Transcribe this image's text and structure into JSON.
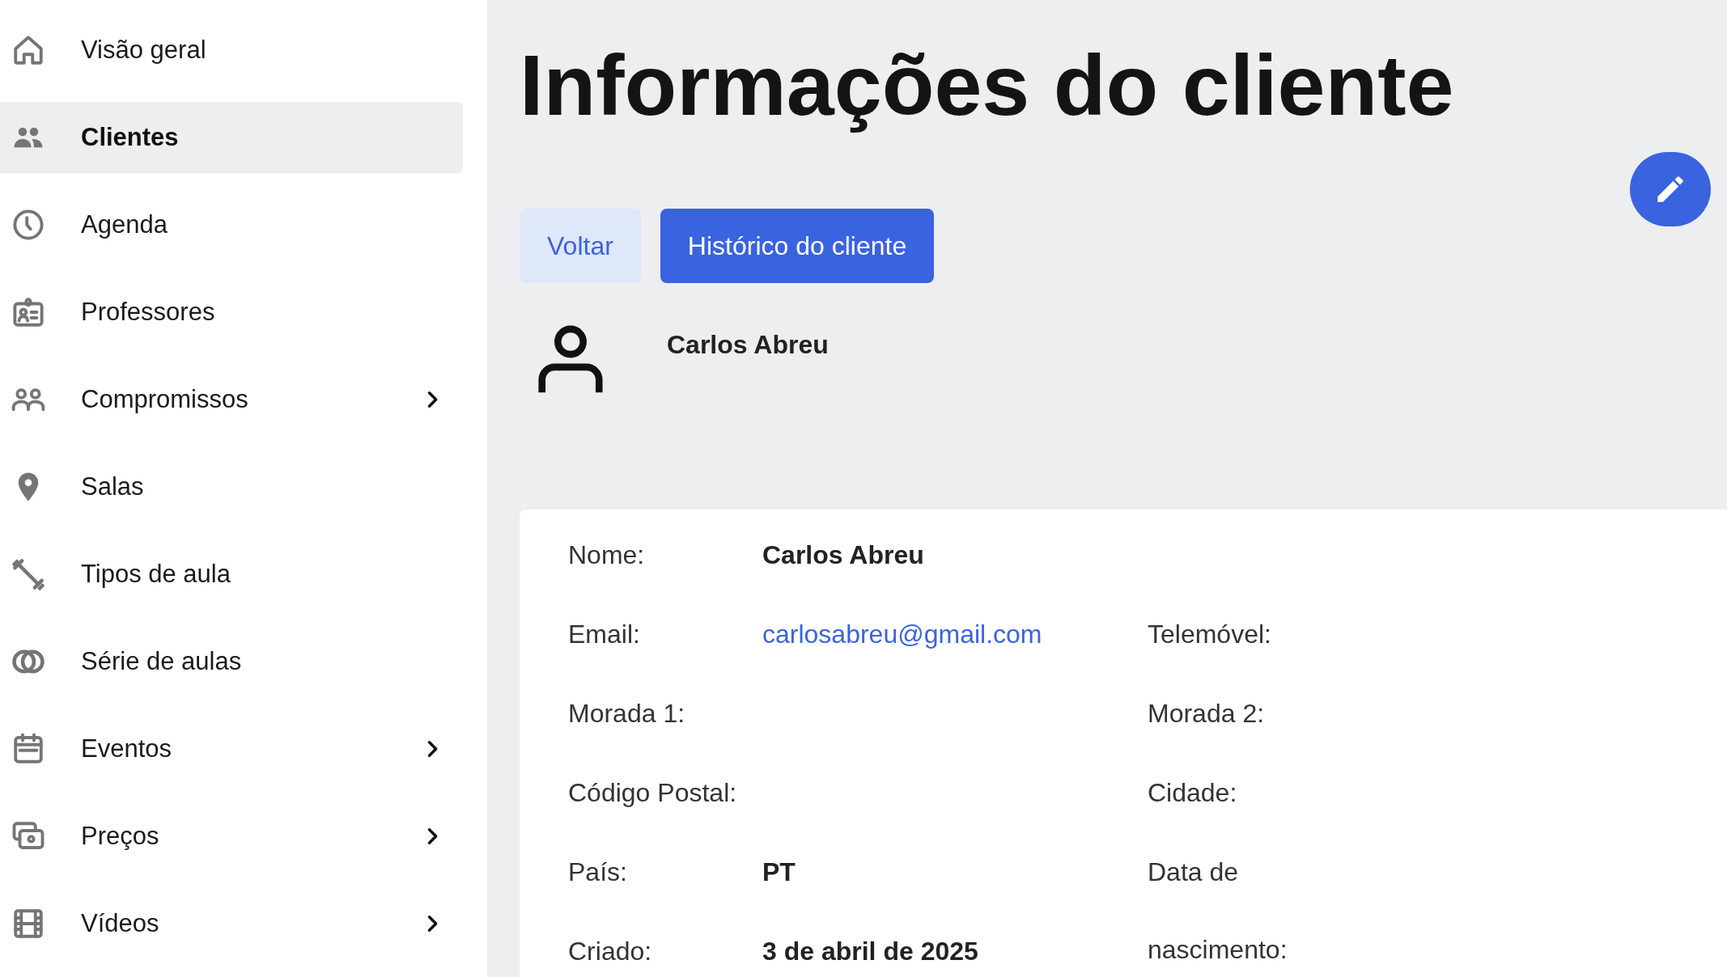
{
  "sidebar": {
    "items": [
      {
        "label": "Visão geral",
        "selected": false,
        "has_submenu": false
      },
      {
        "label": "Clientes",
        "selected": true,
        "has_submenu": false
      },
      {
        "label": "Agenda",
        "selected": false,
        "has_submenu": false
      },
      {
        "label": "Professores",
        "selected": false,
        "has_submenu": false
      },
      {
        "label": "Compromissos",
        "selected": false,
        "has_submenu": true
      },
      {
        "label": "Salas",
        "selected": false,
        "has_submenu": false
      },
      {
        "label": "Tipos de aula",
        "selected": false,
        "has_submenu": false
      },
      {
        "label": "Série de aulas",
        "selected": false,
        "has_submenu": false
      },
      {
        "label": "Eventos",
        "selected": false,
        "has_submenu": true
      },
      {
        "label": "Preços",
        "selected": false,
        "has_submenu": true
      },
      {
        "label": "Vídeos",
        "selected": false,
        "has_submenu": true
      }
    ]
  },
  "page": {
    "title": "Informações do cliente"
  },
  "buttons": [
    {
      "label": "Voltar",
      "kind": "secondary"
    },
    {
      "label": "Histórico do cliente",
      "kind": "primary"
    }
  ],
  "client": {
    "name": "Carlos Abreu"
  },
  "details": {
    "rows": [
      {
        "left": {
          "label": "Nome:",
          "value": "Carlos Abreu",
          "kind": "text"
        }
      },
      {
        "left": {
          "label": "Email:",
          "value": "carlosabreu@gmail.com",
          "kind": "link"
        },
        "right": {
          "label": "Telemóvel:"
        }
      },
      {
        "left": {
          "label": "Morada 1:"
        },
        "right": {
          "label": "Morada 2:"
        }
      },
      {
        "left": {
          "label": "Código Postal:"
        },
        "right": {
          "label": "Cidade:"
        }
      },
      {
        "left": {
          "label": "País:",
          "value": "PT",
          "kind": "text"
        },
        "right": {
          "label": "Data de nascimento:"
        }
      },
      {
        "left": {
          "label": "Criado:",
          "value": "3 de abril de 2025",
          "kind": "text"
        }
      }
    ]
  }
}
